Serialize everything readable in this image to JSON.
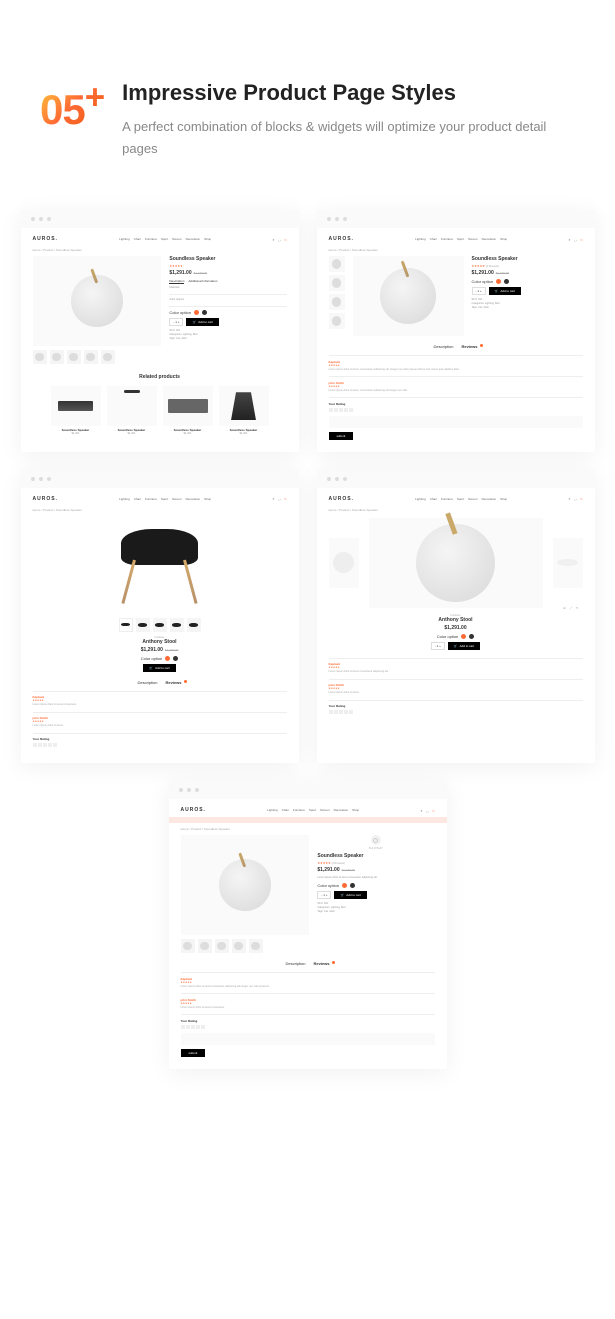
{
  "hero": {
    "badge": "05",
    "plus": "+",
    "title": "Impressive Product Page Styles",
    "subtitle": "A perfect combination of blocks & widgets will optimize your product detail pages"
  },
  "common": {
    "logo": "AUROS.",
    "nav": [
      "Lighting",
      "Chair",
      "Furniture",
      "Sport",
      "Screen",
      "Decoration",
      "Shop"
    ],
    "breadcrumb": "Home / Product / Soundless Speaker",
    "search_icon": "⌕",
    "user_icon": "◡",
    "cart_icon": "⌂"
  },
  "product1": {
    "title": "Soundless Speaker",
    "price": "$1,291.00",
    "old_price": "$1,470.00",
    "tabs": {
      "desc": "Description",
      "addl": "Additional Information"
    },
    "desc1": "Materials",
    "desc2": "Color options",
    "color_label": "Color option",
    "qty": "- 1 +",
    "btn": "Add to cart",
    "meta": {
      "sku": "SKU: N/A",
      "cat": "Categories: Lighting, Bed",
      "tags": "Tags: Cat, dolor"
    },
    "related_title": "Related products",
    "related": [
      {
        "name": "Soundless Speaker",
        "price": "$1,291"
      },
      {
        "name": "Soundless Speaker",
        "price": "$1,291"
      },
      {
        "name": "Soundless Speaker",
        "price": "$1,291"
      },
      {
        "name": "Soundless Speaker",
        "price": "$1,291"
      }
    ]
  },
  "product2": {
    "title": "Soundless Speaker",
    "reviews_count": "(2 Reviews)",
    "price": "$1,291.00",
    "old_price": "$1,470.00",
    "color_label": "Color option",
    "qty": "- 1 +",
    "btn": "Add to cart",
    "meta": {
      "sku": "SKU: N/A",
      "cat": "Categories: Lighting, Bed",
      "tags": "Tags: Cat, dolor"
    },
    "tabs": {
      "desc": "Description",
      "rev": "Reviews"
    },
    "reviews": [
      {
        "name": "Kaplasti",
        "text": "Lorem ipsum dolor sit amet, consectetur adipiscing elit. Integer nec odio praesent libero sed cursus ante dapibus diam."
      },
      {
        "name": "john Smith",
        "text": "Lorem ipsum dolor sit amet, consectetur adipiscing elit integer nec odio."
      }
    ],
    "rating_label": "Your Rating",
    "submit": "submit"
  },
  "product3": {
    "title": "Anthony Stool",
    "price": "$1,291.00",
    "old_price": "$1,470.00",
    "color_label": "Color option",
    "btn": "Add to cart",
    "tabs": {
      "desc": "Description",
      "rev": "Reviews"
    },
    "reviews": [
      {
        "name": "Kaplasti",
        "text": "Lorem ipsum dolor sit amet consectetur."
      },
      {
        "name": "john Smith",
        "text": "Lorem ipsum dolor sit amet."
      }
    ],
    "rating_label": "Your Rating"
  },
  "product4": {
    "cat": "Furniture",
    "title": "Anthony Stool",
    "price": "$1,291.00",
    "color_label": "Color option",
    "qty": "- 1 +",
    "btn": "Add to cart",
    "reviews": [
      {
        "name": "Kaplasti",
        "text": "Lorem ipsum dolor sit amet consectetur adipiscing elit."
      },
      {
        "name": "john Smith",
        "text": "Lorem ipsum dolor sit amet."
      }
    ],
    "rating_label": "Your Rating"
  },
  "product5": {
    "brand": "B & O PLAY",
    "title": "Soundless Speaker",
    "reviews_count": "(2 Reviews)",
    "price": "$1,291.00",
    "old_price": "$1,470.00",
    "desc": "Lorem ipsum dolor sit amet consectetur adipiscing elit.",
    "color_label": "Color option",
    "qty": "- 1 +",
    "btn": "Add to cart",
    "meta": {
      "sku": "SKU: N/A",
      "cat": "Categories: Lighting, Bed",
      "tags": "Tags: Cat, dolor"
    },
    "tabs": {
      "desc": "Description",
      "rev": "Reviews"
    },
    "reviews": [
      {
        "name": "Kaplasti",
        "text": "Lorem ipsum dolor sit amet consectetur adipiscing elit integer nec odio praesent."
      },
      {
        "name": "john Smith",
        "text": "Lorem ipsum dolor sit amet consectetur."
      }
    ],
    "rating_label": "Your Rating",
    "submit": "submit"
  }
}
